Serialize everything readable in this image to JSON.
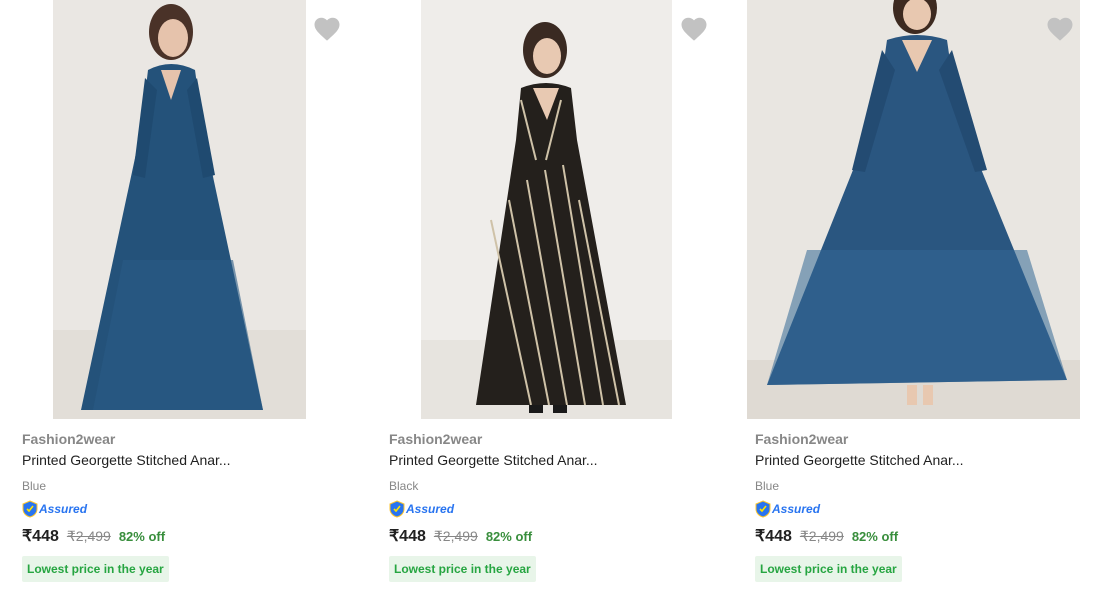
{
  "products": [
    {
      "brand": "Fashion2wear",
      "title": "Printed Georgette Stitched Anar...",
      "color": "Blue",
      "assured_label": "Assured",
      "price": "₹448",
      "mrp": "₹2,499",
      "discount": "82% off",
      "deal_badge": "Lowest price in the year",
      "image_icon": "blue-anarkali-dress-photo"
    },
    {
      "brand": "Fashion2wear",
      "title": "Printed Georgette Stitched Anar...",
      "color": "Black",
      "assured_label": "Assured",
      "price": "₹448",
      "mrp": "₹2,499",
      "discount": "82% off",
      "deal_badge": "Lowest price in the year",
      "image_icon": "black-striped-anarkali-dress-photo"
    },
    {
      "brand": "Fashion2wear",
      "title": "Printed Georgette Stitched Anar...",
      "color": "Blue",
      "assured_label": "Assured",
      "price": "₹448",
      "mrp": "₹2,499",
      "discount": "82% off",
      "deal_badge": "Lowest price in the year",
      "image_icon": "blue-flared-anarkali-dress-photo"
    }
  ],
  "colors": {
    "brand_text": "#878787",
    "assured_blue": "#2874f0",
    "discount_green": "#388e3c",
    "deal_bg": "#e8f5e9",
    "deal_text": "#26a541",
    "wishlist_heart": "#c2c2c2"
  },
  "icons": {
    "wishlist": "heart-icon",
    "assured": "assured-shield-icon"
  }
}
